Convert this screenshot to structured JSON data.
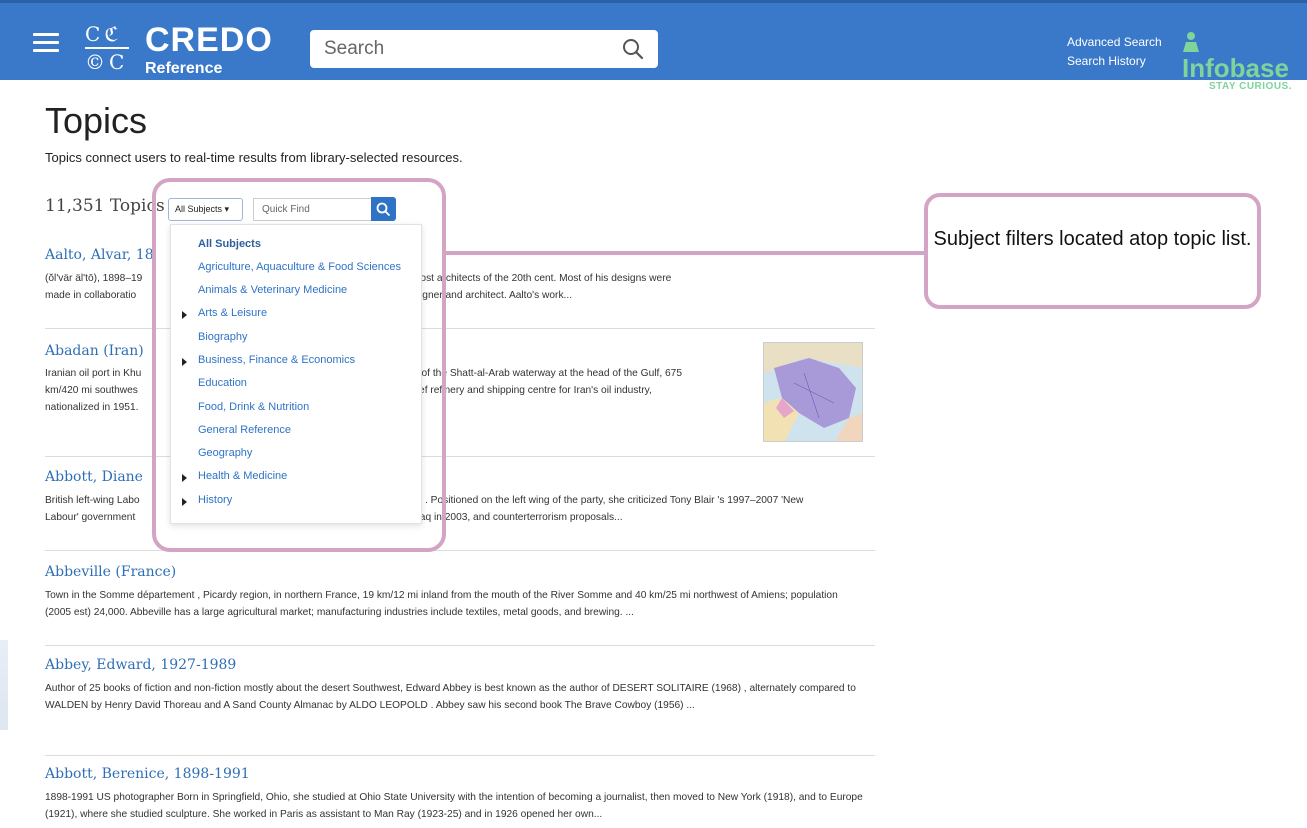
{
  "header": {
    "logo_text": "CREDO",
    "logo_sub": "Reference",
    "search_placeholder": "Search",
    "links": [
      "Advanced Search",
      "Search History"
    ],
    "partner_logo": "Infobase",
    "partner_tagline": "STAY CURIOUS."
  },
  "page": {
    "title": "Topics",
    "subtitle": "Topics connect users to real-time results from library-selected resources.",
    "count": "11,351 Topics"
  },
  "filters": {
    "subject_selected": "All Subjects",
    "quick_find_placeholder": "Quick Find",
    "subjects": [
      {
        "label": "All Subjects",
        "selected": true,
        "expandable": false
      },
      {
        "label": "Agriculture, Aquaculture & Food Sciences",
        "expandable": false
      },
      {
        "label": "Animals & Veterinary Medicine",
        "expandable": false
      },
      {
        "label": "Arts & Leisure",
        "expandable": true
      },
      {
        "label": "Biography",
        "expandable": false
      },
      {
        "label": "Business, Finance & Economics",
        "expandable": true
      },
      {
        "label": "Education",
        "expandable": false
      },
      {
        "label": "Food, Drink & Nutrition",
        "expandable": false
      },
      {
        "label": "General Reference",
        "expandable": false
      },
      {
        "label": "Geography",
        "expandable": false
      },
      {
        "label": "Health & Medicine",
        "expandable": true
      },
      {
        "label": "History",
        "expandable": true
      }
    ]
  },
  "topics": [
    {
      "title": "Aalto, Alvar, 18",
      "desc1_left": "(ŏl'vär äl'tō), 1898–19",
      "desc1_right": "ered one of the foremost architects of the 20th cent. Most of his designs were",
      "desc2_left": "made in collaboratio",
      "desc2_right": "celebrated furniture designer and architect. Aalto's work..."
    },
    {
      "title": "Abadan (Iran)",
      "desc1_left": "Iranian oil port in Khu",
      "desc1_right": "e of the Shatt-al-Arab waterway at the head of the Gulf, 675",
      "desc2_left": "km/420 mi southwes",
      "desc2_right": "chief refinery and shipping centre for Iran's oil industry,",
      "desc3_left": "nationalized in 1951.",
      "has_map": true
    },
    {
      "title": "Abbott, Diane",
      "desc1_left": "British left-wing Labo",
      "desc1_right": ". Positioned on the left wing of the party, she criticized Tony Blair 's 1997–2007 'New",
      "desc2_left": "Labour' government",
      "desc2_right": "tary action in Iraq in 2003, and counterterrorism proposals..."
    },
    {
      "title": "Abbeville (France)",
      "desc": "Town in the Somme département , Picardy region, in northern France, 19 km/12 mi inland from the mouth of the River Somme and 40 km/25 mi northwest of Amiens; population (2005 est) 24,000. Abbeville has a large agricultural market; manufacturing industries include textiles, metal goods, and brewing. ..."
    },
    {
      "title": "Abbey, Edward, 1927-1989",
      "desc": "Author of 25 books of fiction and non-fiction mostly about the desert Southwest, Edward Abbey is best known as the author of DESERT SOLITAIRE (1968) , alternately compared to WALDEN by Henry David Thoreau and A Sand County Almanac by ALDO LEOPOLD . Abbey saw his second book The Brave Cowboy (1956) ..."
    },
    {
      "title": "Abbott, Berenice, 1898-1991",
      "desc": "1898-1991 US photographer Born in Springfield, Ohio, she studied at Ohio State University with the intention of becoming a journalist, then moved to New York (1918), and to Europe (1921), where she studied sculpture. She worked in Paris as assistant to Man Ray (1923-25) and in 1926 opened her own..."
    }
  ],
  "annotation": {
    "callout_text": "Subject filters located atop topic list."
  },
  "colors": {
    "header_bg": "#3a78c9",
    "link_blue": "#2f6fb6",
    "annotation_pink": "#d4a4c4",
    "infobase_green": "#7fd39b"
  }
}
